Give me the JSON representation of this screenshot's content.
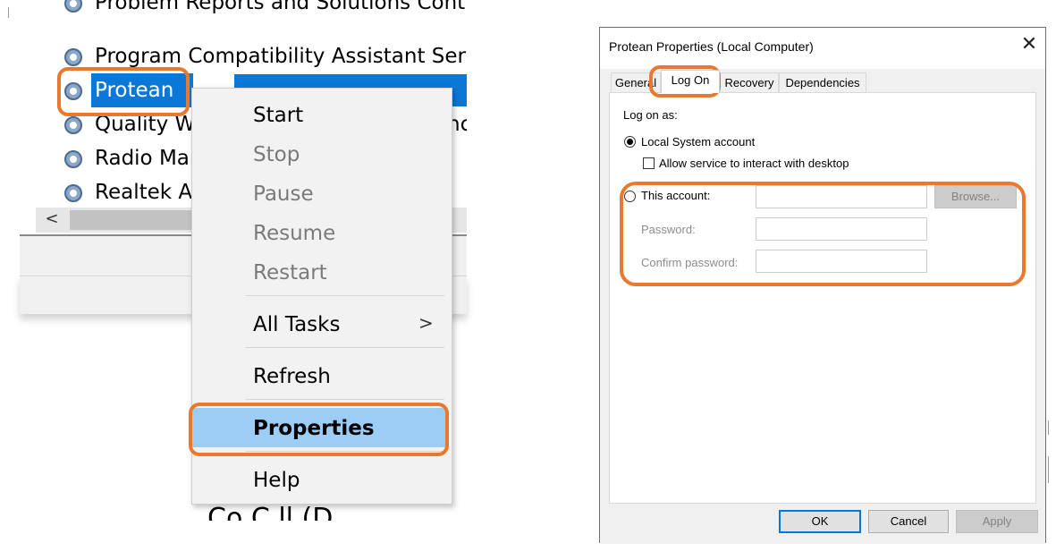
{
  "services": {
    "rows": [
      {
        "label": "Problem Reports and Solutions Control"
      },
      {
        "label": "Program Compatibility Assistant Service"
      },
      {
        "label": "Protean"
      },
      {
        "label": "Quality W"
      },
      {
        "label": "Radio Man"
      },
      {
        "label": "Realtek Au"
      }
    ],
    "partial_right_text": "nc",
    "scroll_left_glyph": "<",
    "bottom_partial_text": "Co  C  ll  (D"
  },
  "context_menu": {
    "start": "Start",
    "stop": "Stop",
    "pause": "Pause",
    "resume": "Resume",
    "restart": "Restart",
    "all_tasks": "All Tasks",
    "all_tasks_arrow": ">",
    "refresh": "Refresh",
    "properties": "Properties",
    "help": "Help"
  },
  "dialog": {
    "title": "Protean Properties (Local Computer)",
    "close_glyph": "✕",
    "tabs": [
      {
        "label": "General",
        "active": false
      },
      {
        "label": "Log On",
        "active": true
      },
      {
        "label": "Recovery",
        "active": false
      },
      {
        "label": "Dependencies",
        "active": false
      }
    ],
    "log_on_as_label": "Log on as:",
    "local_system_account_label": "Local System account",
    "local_system_selected": true,
    "allow_interact_label": "Allow service to interact with desktop",
    "allow_interact_checked": false,
    "this_account_label": "This account:",
    "this_account_value": "",
    "browse_label": "Browse...",
    "password_label": "Password:",
    "password_value": "",
    "confirm_password_label": "Confirm password:",
    "confirm_password_value": "",
    "ok_label": "OK",
    "cancel_label": "Cancel",
    "apply_label": "Apply"
  },
  "colors": {
    "selection_blue": "#0a78d7",
    "menu_highlight": "#9ccdf5",
    "annotation_orange": "#e8792f"
  },
  "icons": {
    "service_icon": "gear-service-icon",
    "submenu": "chevron-right-icon",
    "scroll_left": "chevron-left-icon",
    "close": "close-icon"
  }
}
